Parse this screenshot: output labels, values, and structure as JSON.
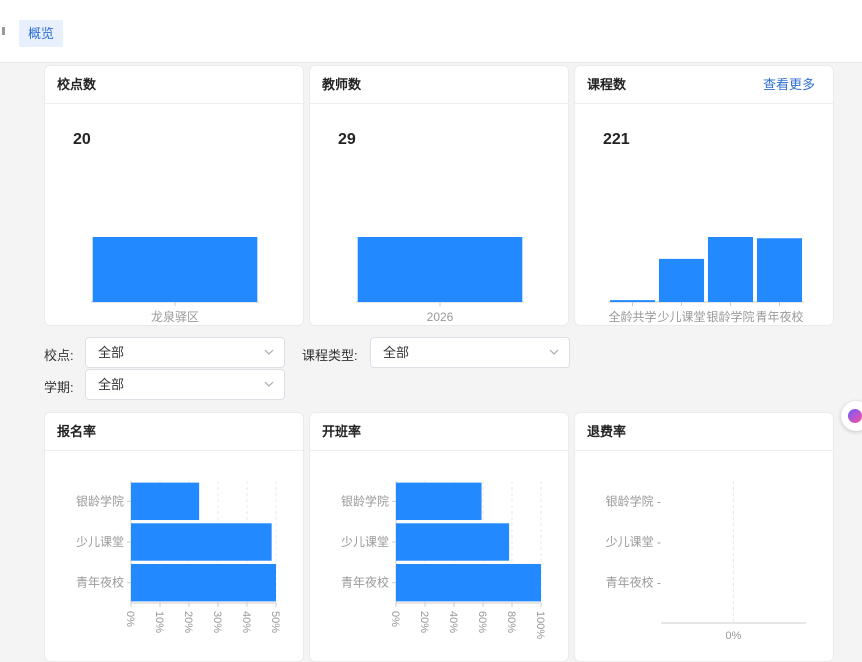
{
  "header": {
    "tab_overview": "概览"
  },
  "cards": {
    "schools": {
      "title": "校点数",
      "total": "20",
      "chart_data": {
        "type": "bar",
        "categories": [
          "龙泉驿区"
        ],
        "values": [
          20
        ]
      }
    },
    "teachers": {
      "title": "教师数",
      "total": "29",
      "chart_data": {
        "type": "bar",
        "categories": [
          "2026"
        ],
        "values": [
          29
        ]
      }
    },
    "courses": {
      "title": "课程数",
      "more": "查看更多",
      "total": "221",
      "chart_data": {
        "type": "bar",
        "categories": [
          "全龄共学",
          "少儿课堂",
          "银龄学院",
          "青年夜校"
        ],
        "values": [
          3,
          69,
          104,
          102
        ]
      }
    },
    "enroll": {
      "title": "报名率",
      "chart_data": {
        "type": "bar",
        "orientation": "horizontal",
        "categories": [
          "银龄学院",
          "少儿课堂",
          "青年夜校"
        ],
        "values": [
          23.5,
          48.5,
          50
        ],
        "xticks": [
          "0%",
          "10%",
          "20%",
          "30%",
          "40%",
          "50%"
        ],
        "xlim": [
          0,
          50
        ]
      }
    },
    "open": {
      "title": "开班率",
      "chart_data": {
        "type": "bar",
        "orientation": "horizontal",
        "categories": [
          "银龄学院",
          "少儿课堂",
          "青年夜校"
        ],
        "values": [
          59,
          78,
          100
        ],
        "xticks": [
          "0%",
          "20%",
          "40%",
          "60%",
          "80%",
          "100%"
        ],
        "xlim": [
          0,
          100
        ]
      }
    },
    "refund": {
      "title": "退费率",
      "chart_data": {
        "type": "bar",
        "orientation": "horizontal",
        "categories": [
          "银龄学院",
          "少儿课堂",
          "青年夜校"
        ],
        "values": [
          0,
          0,
          0
        ],
        "xticks": [
          "0%"
        ]
      }
    }
  },
  "filters": {
    "school": {
      "label": "校点:",
      "value": "全部"
    },
    "course_type": {
      "label": "课程类型:",
      "value": "全部"
    },
    "term": {
      "label": "学期:",
      "value": "全部"
    }
  },
  "colors": {
    "bar": "#2289ff",
    "accent": "#2d6fd6",
    "axis": "#cccccc",
    "tick_text": "#999999"
  }
}
